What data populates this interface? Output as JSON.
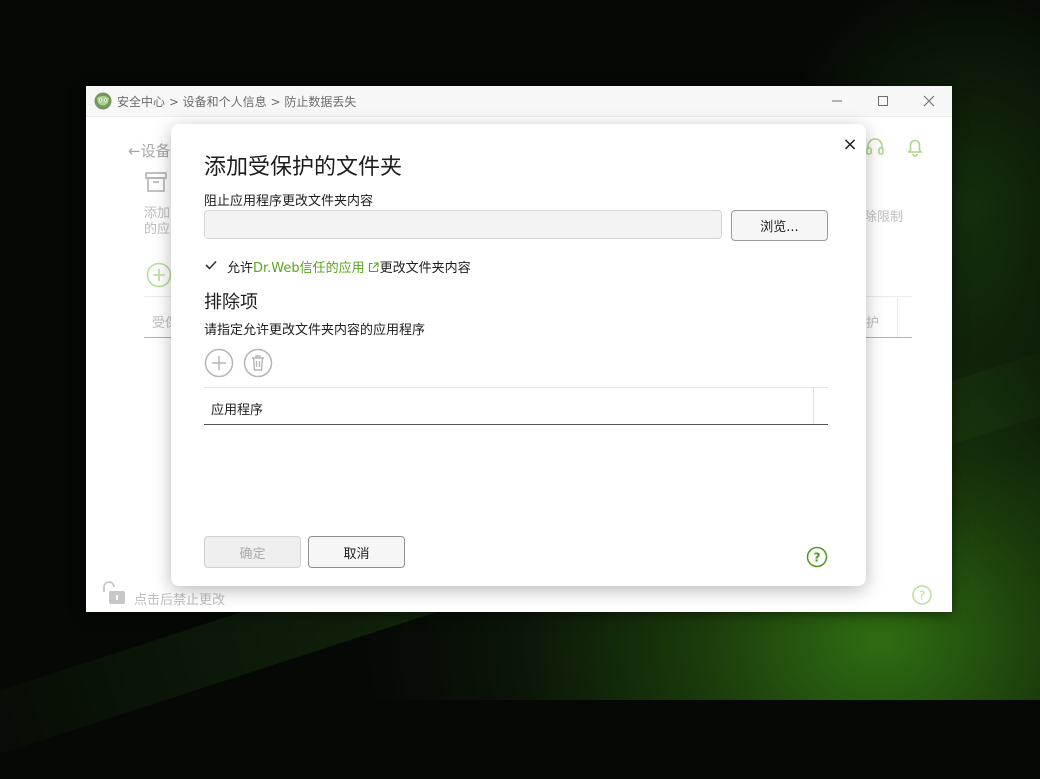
{
  "window": {
    "breadcrumb": "安全中心 > 设备和个人信息 > 防止数据丢失",
    "controls": {
      "minimize": "—",
      "maximize": "☐",
      "close": "✕"
    }
  },
  "background": {
    "back_label": "设备",
    "desc_fragment": "添加 的应",
    "right_fragment": "除限制",
    "column_left": "受保",
    "column_right": "护",
    "lock_text": "点击后禁止更改"
  },
  "dialog": {
    "title": "添加受保护的文件夹",
    "path_label": "阻止应用程序更改文件夹内容",
    "path_value": "",
    "browse_label": "浏览...",
    "allow_prefix": "允许",
    "allow_link": "Dr.Web信任的应用",
    "allow_suffix": "更改文件夹内容",
    "allow_checked": true,
    "exclusions_title": "排除项",
    "exclusions_desc": "请指定允许更改文件夹内容的应用程序",
    "list_header": "应用程序",
    "ok_label": "确定",
    "cancel_label": "取消",
    "close_glyph": "×"
  },
  "colors": {
    "accent": "#5aa51f",
    "disabled_text": "#a9a9a9"
  },
  "icons": [
    "drweb-logo-icon",
    "back-arrow-icon",
    "headset-icon",
    "bell-icon",
    "archive-box-icon",
    "add-circle-icon",
    "trash-icon",
    "external-link-icon",
    "check-icon",
    "help-icon",
    "lock-open-icon"
  ]
}
